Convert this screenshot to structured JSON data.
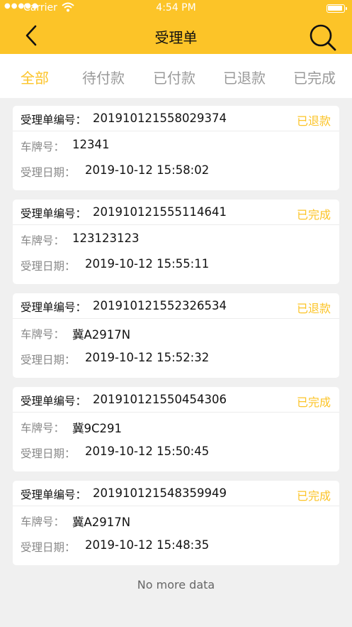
{
  "status_bar": {
    "carrier": "Carrier",
    "time": "4:54 PM"
  },
  "nav": {
    "title": "受理单"
  },
  "tabs": [
    "全部",
    "待付款",
    "已付款",
    "已退款",
    "已完成"
  ],
  "labels": {
    "order_no": "受理单编号：",
    "plate": "车牌号：",
    "date": "受理日期："
  },
  "orders": [
    {
      "order_no": "201910121558029374",
      "status": "已退款",
      "plate": "12341",
      "date": "2019-10-12 15:58:02"
    },
    {
      "order_no": "201910121555114641",
      "status": "已完成",
      "plate": "123123123",
      "date": "2019-10-12 15:55:11"
    },
    {
      "order_no": "201910121552326534",
      "status": "已退款",
      "plate": "冀A2917N",
      "date": "2019-10-12 15:52:32"
    },
    {
      "order_no": "201910121550454306",
      "status": "已完成",
      "plate": "冀9C291",
      "date": "2019-10-12 15:50:45"
    },
    {
      "order_no": "201910121548359949",
      "status": "已完成",
      "plate": "冀A2917N",
      "date": "2019-10-12 15:48:35"
    }
  ],
  "footer": "No more data",
  "colors": {
    "accent": "#fcc428",
    "background": "#f0f0f0"
  }
}
